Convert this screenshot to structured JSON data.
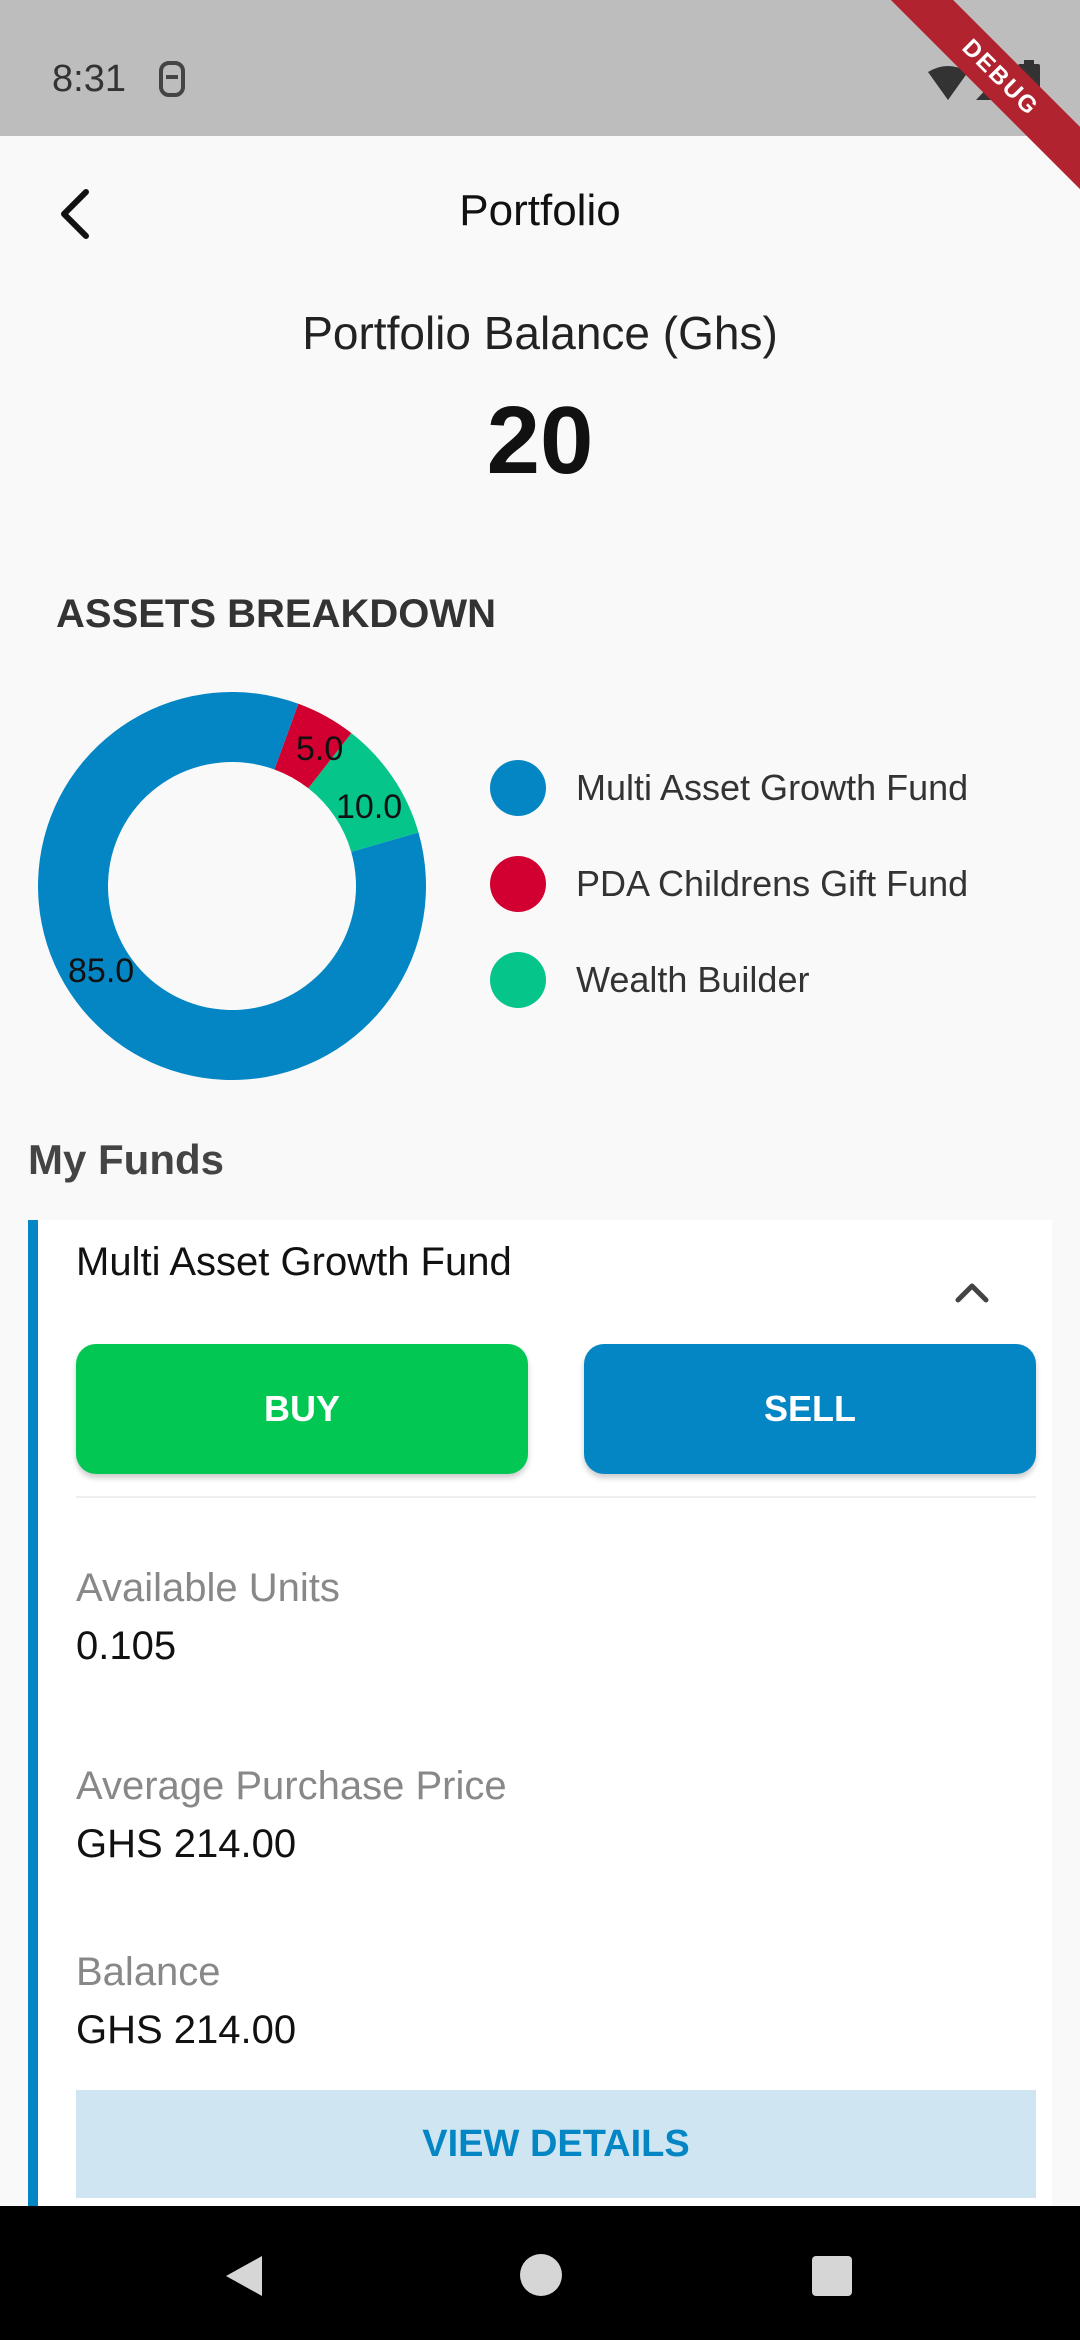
{
  "status": {
    "time": "8:31",
    "debug_label": "DEBUG"
  },
  "header": {
    "title": "Portfolio"
  },
  "portfolio": {
    "balance_label": "Portfolio Balance (Ghs)",
    "balance_value": "20"
  },
  "assets": {
    "title": "ASSETS BREAKDOWN",
    "legend": [
      {
        "label": "Multi Asset Growth Fund",
        "color": "#0586c4"
      },
      {
        "label": "PDA Childrens Gift Fund",
        "color": "#d10031"
      },
      {
        "label": "Wealth Builder",
        "color": "#05c58b"
      }
    ],
    "slice_values": [
      "85.0",
      "5.0",
      "10.0"
    ]
  },
  "chart_data": {
    "type": "pie",
    "categories": [
      "Multi Asset Growth Fund",
      "PDA Childrens Gift Fund",
      "Wealth Builder"
    ],
    "values": [
      85.0,
      5.0,
      10.0
    ],
    "title": "",
    "legend": "right"
  },
  "funds": {
    "title": "My Funds",
    "fund": {
      "name": "Multi Asset Growth Fund",
      "buy_label": "BUY",
      "sell_label": "SELL",
      "units_label": "Available Units",
      "units_value": "0.105",
      "avg_price_label": "Average Purchase Price",
      "avg_price_value": "GHS 214.00",
      "balance_label": "Balance",
      "balance_value": "GHS 214.00",
      "details_label": "VIEW DETAILS"
    }
  }
}
